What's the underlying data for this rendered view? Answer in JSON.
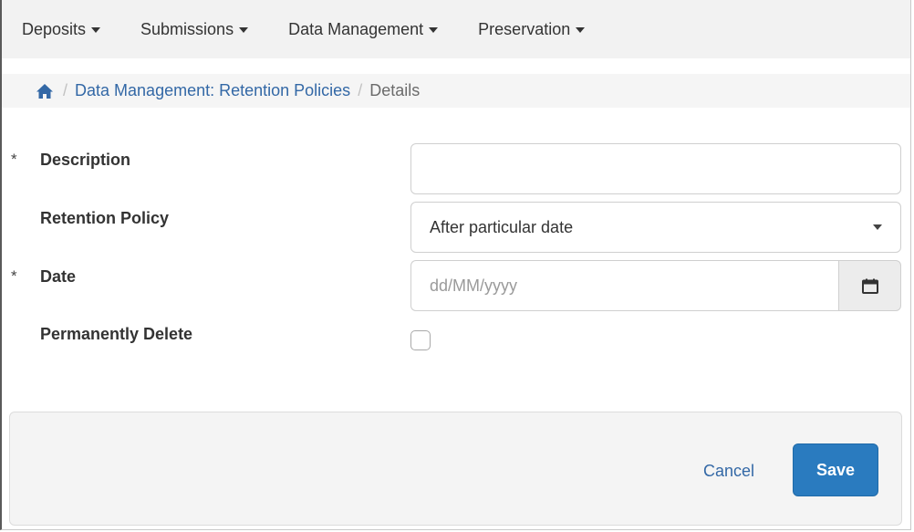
{
  "topnav": {
    "items": [
      {
        "label": "Deposits"
      },
      {
        "label": "Submissions"
      },
      {
        "label": "Data Management"
      },
      {
        "label": "Preservation"
      }
    ]
  },
  "breadcrumb": {
    "home_icon": "home-icon",
    "separator": "/",
    "link": "Data Management: Retention Policies",
    "current": "Details"
  },
  "form": {
    "required_marker": "*",
    "description": {
      "label": "Description",
      "value": ""
    },
    "retention_policy": {
      "label": "Retention Policy",
      "value": "After particular date"
    },
    "date": {
      "label": "Date",
      "placeholder": "dd/MM/yyyy",
      "value": "",
      "icon": "calendar-icon"
    },
    "permanently_delete": {
      "label": "Permanently Delete",
      "checked": false
    }
  },
  "footer": {
    "cancel_label": "Cancel",
    "save_label": "Save"
  },
  "colors": {
    "link": "#3368a6",
    "primary_button": "#2a7bbf",
    "nav_bg": "#f2f2f2"
  }
}
